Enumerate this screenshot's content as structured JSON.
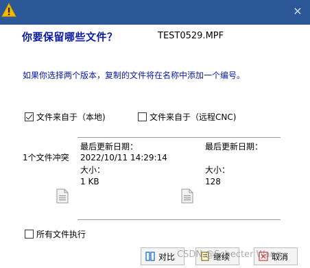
{
  "dialog": {
    "heading": "你要保留哪些文件？",
    "filename": "TEST0529.MPF",
    "description": "如果你选择两个版本，复制的文件将在名称中添加一个编号。",
    "close_glyph": "✕"
  },
  "options": {
    "keep_local_label": "文件来自于（本地)",
    "keep_local_checked": true,
    "keep_remote_label": "文件来自于（远程CNC)",
    "keep_remote_checked": false,
    "apply_all_label": "所有文件执行",
    "apply_all_checked": false
  },
  "conflict": {
    "label": "1个文件冲突",
    "local": {
      "modified_label": "最后更新日期：",
      "modified_value": "2022/10/11 14:29:14",
      "size_label": "大小：",
      "size_value": "1 KB"
    },
    "remote": {
      "modified_label": "最后更新日期：",
      "modified_value": "",
      "size_label": "大小：",
      "size_value": "128"
    }
  },
  "buttons": {
    "compare": "对比",
    "continue": "继续",
    "cancel": "取消"
  },
  "watermark": "CSDN @Schecter Wang",
  "colors": {
    "titlebar": "#2b5797",
    "heading": "#0a1aa3",
    "warning_icon": "#f5b800",
    "compare_icon": "#1a73c8",
    "cancel_icon": "#e04040"
  }
}
